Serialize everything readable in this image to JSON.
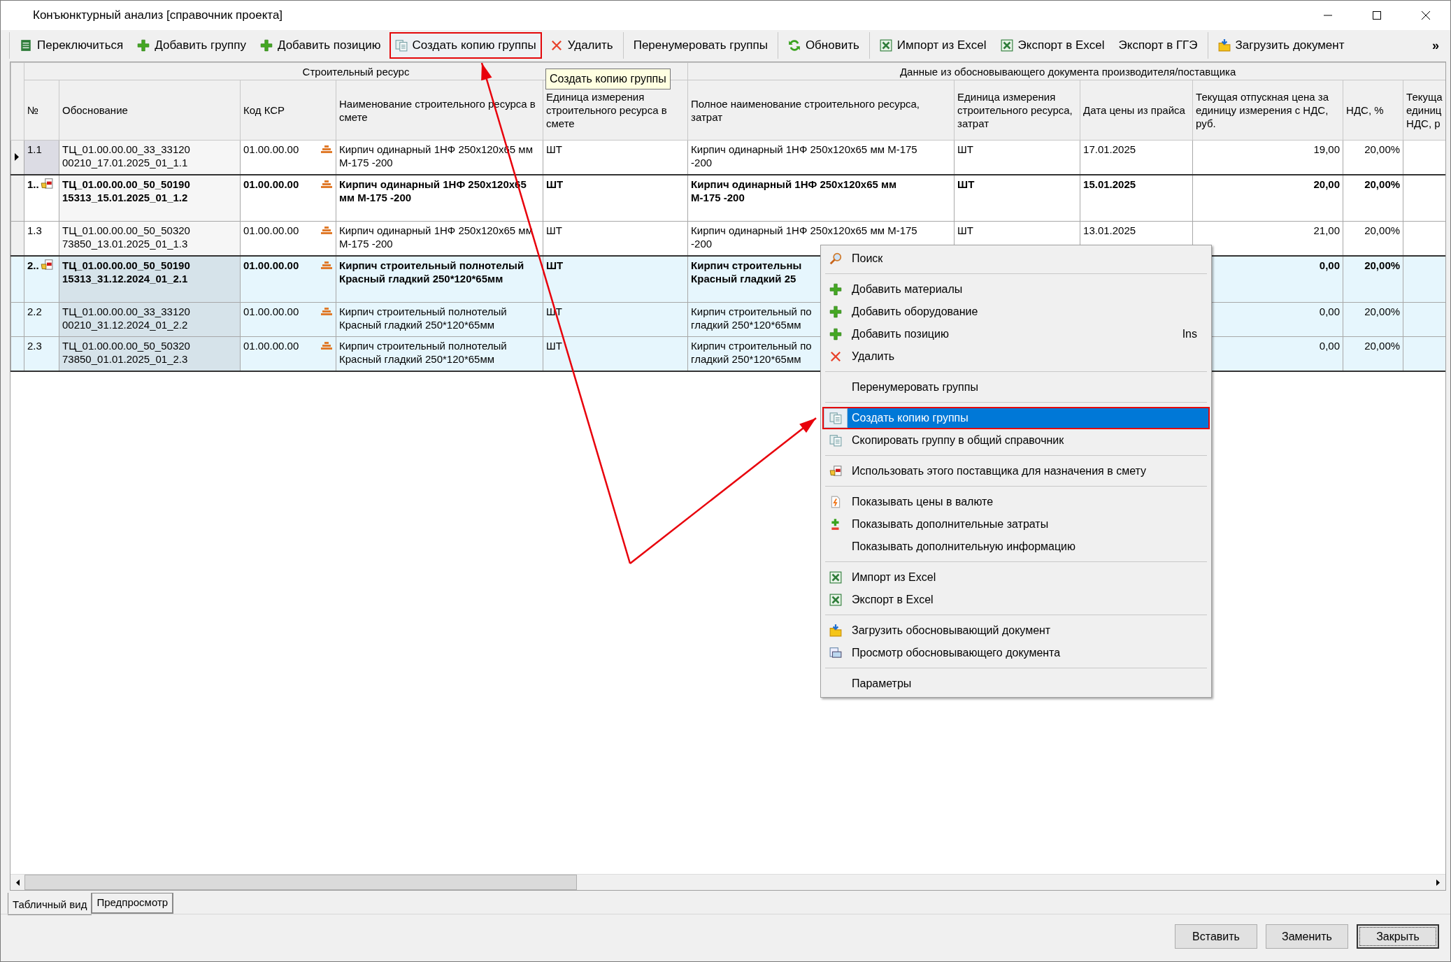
{
  "window": {
    "title": "Конъюнктурный анализ [справочник проекта]"
  },
  "toolbar": {
    "groups": [
      {
        "items": [
          {
            "label": "Переключиться",
            "highlighted": false
          },
          {
            "label": "Добавить группу",
            "highlighted": false
          },
          {
            "label": "Добавить позицию",
            "highlighted": false
          },
          {
            "label": "Создать копию группы",
            "highlighted": true
          },
          {
            "label": "Удалить",
            "highlighted": false
          }
        ]
      },
      {
        "items": [
          {
            "label": "Перенумеровать группы",
            "highlighted": false
          }
        ]
      },
      {
        "items": [
          {
            "label": "Обновить",
            "highlighted": false
          }
        ]
      },
      {
        "items": [
          {
            "label": "Импорт из Excel",
            "highlighted": false
          },
          {
            "label": "Экспорт в Excel",
            "highlighted": false
          },
          {
            "label": "Экспорт в ГГЭ",
            "highlighted": false
          }
        ]
      },
      {
        "items": [
          {
            "label": "Загрузить документ",
            "highlighted": false
          }
        ]
      }
    ],
    "overflow": "»"
  },
  "tooltip": "Создать копию группы",
  "grid": {
    "column_groups": [
      {
        "label": "Строительный ресурс",
        "columns": [
          "№",
          "Обоснование",
          "Код КСР",
          "Наименование строительного ресурса в смете",
          "Единица измерения строительного ресурса в смете"
        ]
      },
      {
        "label": "Данные из обосновывающего документа производителя/поставщика",
        "columns": [
          "Полное наименование строительного ресурса, затрат",
          "Единица измерения строительного ресурса, затрат",
          "Дата цены из прайса",
          "Текущая отпускная цена за единицу измерения с НДС, руб.",
          "НДС, %",
          "Текуща единиц НДС, р"
        ]
      }
    ],
    "rows": [
      {
        "kind": "item",
        "current": true,
        "highlighted": false,
        "cells": [
          "1.1",
          "ТЦ_01.00.00.00_33_3312000210_17.01.2025_01_1.1",
          "01.00.00.00",
          "Кирпич одинарный 1НФ 250x120x65 мм М-175 -200",
          "ШТ",
          "Кирпич одинарный 1НФ 250x120x65 мм М-175\n-200",
          "ШТ",
          "17.01.2025",
          "19,00",
          "20,00%",
          null
        ]
      },
      {
        "kind": "group",
        "current": false,
        "highlighted": false,
        "cells": [
          "1..",
          "ТЦ_01.00.00.00_50_5019015313_15.01.2025_01_1.2",
          "01.00.00.00",
          "Кирпич одинарный 1НФ 250x120x65 мм М-175 -200",
          "ШТ",
          "Кирпич одинарный 1НФ 250x120x65 мм\nМ-175 -200",
          "ШТ",
          "15.01.2025",
          "20,00",
          "20,00%",
          null
        ]
      },
      {
        "kind": "item",
        "current": false,
        "highlighted": false,
        "cells": [
          "1.3",
          "ТЦ_01.00.00.00_50_5032073850_13.01.2025_01_1.3",
          "01.00.00.00",
          "Кирпич одинарный 1НФ 250x120x65 мм М-175 -200",
          "ШТ",
          "Кирпич одинарный 1НФ 250x120x65 мм М-175\n-200",
          "ШТ",
          "13.01.2025",
          "21,00",
          "20,00%",
          null
        ]
      },
      {
        "kind": "group",
        "current": false,
        "highlighted": true,
        "cells": [
          "2..",
          "ТЦ_01.00.00.00_50_5019015313_31.12.2024_01_2.1",
          "01.00.00.00",
          "Кирпич строительный полнотелый Красный гладкий 250*120*65мм",
          "ШТ",
          "Кирпич строительны\nКрасный гладкий 25",
          null,
          null,
          "0,00",
          "20,00%",
          null
        ]
      },
      {
        "kind": "item",
        "current": false,
        "highlighted": true,
        "cells": [
          "2.2",
          "ТЦ_01.00.00.00_33_3312000210_31.12.2024_01_2.2",
          "01.00.00.00",
          "Кирпич строительный полнотелый Красный гладкий 250*120*65мм",
          "ШТ",
          "Кирпич строительный по\nгладкий 250*120*65мм",
          null,
          null,
          "0,00",
          "20,00%",
          null
        ]
      },
      {
        "kind": "item",
        "current": false,
        "highlighted": true,
        "cells": [
          "2.3",
          "ТЦ_01.00.00.00_50_5032073850_01.01.2025_01_2.3",
          "01.00.00.00",
          "Кирпич строительный полнотелый Красный гладкий 250*120*65мм",
          "ШТ",
          "Кирпич строительный по\nгладкий 250*120*65мм",
          null,
          null,
          "0,00",
          "20,00%",
          null
        ]
      }
    ]
  },
  "context_menu": {
    "groups": [
      {
        "items": [
          {
            "label": "Поиск",
            "selected": false,
            "highlighted": false
          }
        ]
      },
      {
        "items": [
          {
            "label": "Добавить материалы",
            "selected": false,
            "highlighted": false
          },
          {
            "label": "Добавить оборудование",
            "selected": false,
            "highlighted": false
          },
          {
            "label": "Добавить позицию",
            "shortcut": "Ins",
            "selected": false,
            "highlighted": false
          },
          {
            "label": "Удалить",
            "selected": false,
            "highlighted": false
          }
        ]
      },
      {
        "items": [
          {
            "label": "Перенумеровать группы",
            "selected": false,
            "highlighted": false
          }
        ]
      },
      {
        "items": [
          {
            "label": "Создать копию группы",
            "selected": true,
            "highlighted": true
          },
          {
            "label": "Скопировать группу в общий справочник",
            "selected": false,
            "highlighted": false
          }
        ]
      },
      {
        "items": [
          {
            "label": "Использовать этого поставщика для назначения в смету",
            "selected": false,
            "highlighted": false
          }
        ]
      },
      {
        "items": [
          {
            "label": "Показывать цены в валюте",
            "selected": false,
            "highlighted": false
          },
          {
            "label": "Показывать дополнительные затраты",
            "selected": false,
            "highlighted": false
          },
          {
            "label": "Показывать дополнительную информацию",
            "selected": false,
            "highlighted": false
          }
        ]
      },
      {
        "items": [
          {
            "label": "Импорт из Excel",
            "selected": false,
            "highlighted": false
          },
          {
            "label": "Экспорт в Excel",
            "selected": false,
            "highlighted": false
          }
        ]
      },
      {
        "items": [
          {
            "label": "Загрузить обосновывающий документ",
            "selected": false,
            "highlighted": false
          },
          {
            "label": "Просмотр обосновывающего документа",
            "selected": false,
            "highlighted": false
          }
        ]
      },
      {
        "items": [
          {
            "label": "Параметры",
            "selected": false,
            "highlighted": false
          }
        ]
      }
    ]
  },
  "view_tabs": [
    {
      "label": "Табличный вид",
      "selected": true
    },
    {
      "label": "Предпросмотр",
      "selected": false
    }
  ],
  "buttons": [
    {
      "label": "Вставить",
      "default": false
    },
    {
      "label": "Заменить",
      "default": false
    },
    {
      "label": "Закрыть",
      "default": true
    }
  ]
}
